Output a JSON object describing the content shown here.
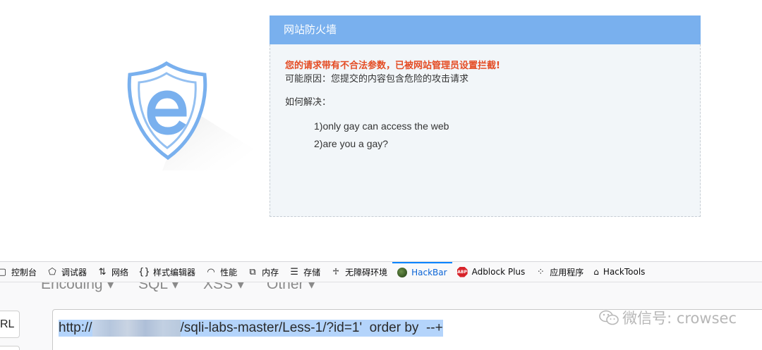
{
  "firewall": {
    "header": "网站防火墙",
    "alert": "您的请求带有不合法参数，已被网站管理员设置拦截!",
    "reason": "可能原因：您提交的内容包含危险的攻击请求",
    "how_label": "如何解决：",
    "items": [
      "1)only gay can access the web",
      "2)are you a gay?"
    ]
  },
  "devtools": {
    "tabs": [
      {
        "label": "控制台",
        "icon": "console-icon"
      },
      {
        "label": "调试器",
        "icon": "debugger-icon"
      },
      {
        "label": "网络",
        "icon": "network-icon"
      },
      {
        "label": "样式编辑器",
        "icon": "style-editor-icon"
      },
      {
        "label": "性能",
        "icon": "performance-icon"
      },
      {
        "label": "内存",
        "icon": "memory-icon"
      },
      {
        "label": "存储",
        "icon": "storage-icon"
      },
      {
        "label": "无障碍环境",
        "icon": "accessibility-icon"
      },
      {
        "label": "HackBar",
        "icon": "hackbar-icon"
      },
      {
        "label": "Adblock Plus",
        "icon": "adblock-icon",
        "badge": "ABP"
      },
      {
        "label": "应用程序",
        "icon": "application-icon"
      },
      {
        "label": "HackTools",
        "icon": "hacktools-icon"
      }
    ],
    "active_tab": "HackBar"
  },
  "hackbar": {
    "menu": [
      "Encoding",
      "SQL",
      "XSS",
      "Other"
    ],
    "url_button": "RL",
    "url_prefix": "http://",
    "url_suffix": "/sqli-labs-master/Less-1/?id=1'  order by  --+"
  },
  "watermark": "微信号: crowsec",
  "colors": {
    "firewall_header": "#79b0ee",
    "alert_text": "#e44c24",
    "active_tab": "#0a84ff",
    "selection": "#b4d4fb"
  }
}
